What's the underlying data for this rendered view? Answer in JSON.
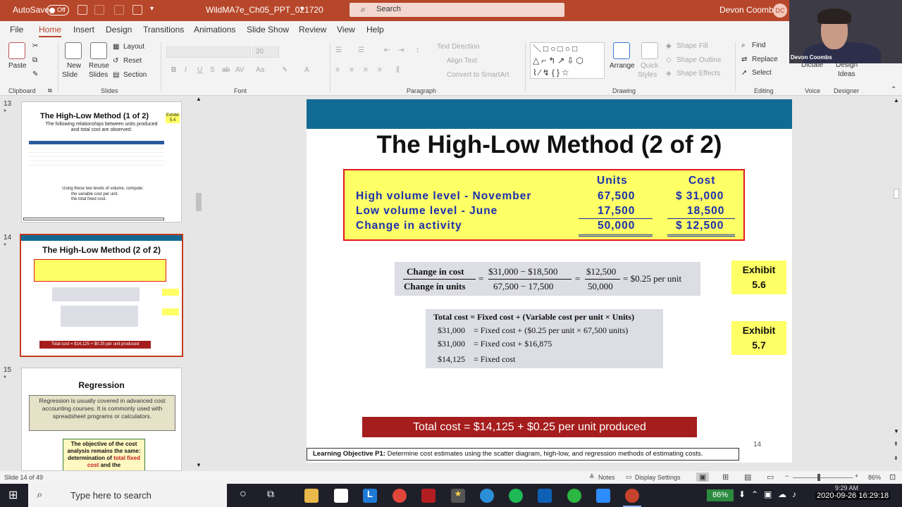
{
  "titlebar": {
    "autosave_label": "AutoSave",
    "autosave_state": "Off",
    "filename": "WildMA7e_Ch05_PPT_021720",
    "search_placeholder": "Search",
    "user_name": "Devon Coombs",
    "user_initials": "DC"
  },
  "tabs": [
    "File",
    "Home",
    "Insert",
    "Design",
    "Transitions",
    "Animations",
    "Slide Show",
    "Review",
    "View",
    "Help"
  ],
  "ribbon": {
    "paste": "Paste",
    "new_slide": "New",
    "new_slide2": "Slide",
    "reuse": "Reuse",
    "reuse2": "Slides",
    "layout": "Layout",
    "reset": "Reset",
    "section": "Section",
    "font_size": "20",
    "text_direction": "Text Direction",
    "align_text": "Align Text",
    "convert_smartart": "Convert to SmartArt",
    "arrange": "Arrange",
    "quick_styles": "Quick",
    "quick_styles2": "Styles",
    "shape_fill": "Shape Fill",
    "shape_outline": "Shape Outline",
    "shape_effects": "Shape Effects",
    "find": "Find",
    "replace": "Replace",
    "select": "Select",
    "dictate": "Dictate",
    "design_ideas": "Design",
    "design_ideas2": "Ideas",
    "groups": {
      "clipboard": "Clipboard",
      "slides": "Slides",
      "font": "Font",
      "paragraph": "Paragraph",
      "drawing": "Drawing",
      "editing": "Editing",
      "voice": "Voice",
      "designer": "Designer"
    }
  },
  "webcam": {
    "name": "Devon Coombs"
  },
  "thumbnails": [
    {
      "number": "13",
      "title": "The High-Low Method (1 of 2)",
      "exhibit": "Exhibit 5.4",
      "subtitle": "The following relationships between units produced and total cost are observed:",
      "note1": "Using these two levels of volume, compute:",
      "note2": "the variable cost per unit.",
      "note3": "the total fixed cost."
    },
    {
      "number": "14",
      "title": "The High-Low Method (2 of 2)",
      "total": "Total cost = $14,125 + $0.25 per unit produced"
    },
    {
      "number": "15",
      "title": "Regression",
      "box1": "Regression is usually covered in advanced cost accounting courses. It is commonly used with spreadsheet programs or calculators.",
      "box2a": "The objective of the cost analysis remains the same: determination of",
      "box2b": "total fixed cost",
      "box2c": "and the"
    }
  ],
  "slide": {
    "title": "The High-Low Method (2 of 2)",
    "table": {
      "col_units": "Units",
      "col_cost": "Cost",
      "rows": [
        {
          "label": "High volume level - November",
          "units": "67,500",
          "cost": "$ 31,000"
        },
        {
          "label": "Low volume level - June",
          "units": "17,500",
          "cost": "18,500"
        },
        {
          "label": "Change in activity",
          "units": "50,000",
          "cost": "$ 12,500"
        }
      ]
    },
    "eq1": {
      "num_label": "Change in cost",
      "den_label": "Change in units",
      "eq": "=",
      "num_values": "$31,000 − $18,500",
      "den_values": "67,500 − 17,500",
      "num_result": "$12,500",
      "den_result": "50,000",
      "result": "= $0.25 per unit"
    },
    "eq2": {
      "line1": "Total cost = Fixed cost + (Variable cost per unit × Units)",
      "line2a": "$31,000",
      "line2b": "= Fixed cost  + ($0.25 per unit × 67,500 units)",
      "line3a": "$31,000",
      "line3b": "= Fixed cost  + $16,875",
      "line4a": "$14,125",
      "line4b": "= Fixed cost"
    },
    "exhibit1": {
      "label": "Exhibit",
      "number": "5.6"
    },
    "exhibit2": {
      "label": "Exhibit",
      "number": "5.7"
    },
    "total_cost": "Total cost  =  $14,125  +  $0.25 per unit produced",
    "learning_objective_label": "Learning Objective P1:",
    "learning_objective_text": "Determine cost estimates using the scatter diagram, high-low, and regression methods of estimating costs.",
    "page_number": "14"
  },
  "status": {
    "slide_info": "Slide 14 of 49",
    "notes": "Notes",
    "display_settings": "Display Settings",
    "zoom": "86%"
  },
  "taskbar": {
    "search_placeholder": "Type here to search",
    "battery": "86%",
    "time": "9:29 AM",
    "timestamp": "2020-09-26 16:29:18"
  },
  "colors": {
    "accent": "#b7472a",
    "slide_band": "#116a94",
    "highlight": "#ffff66",
    "total_bar": "#a51d1d"
  }
}
